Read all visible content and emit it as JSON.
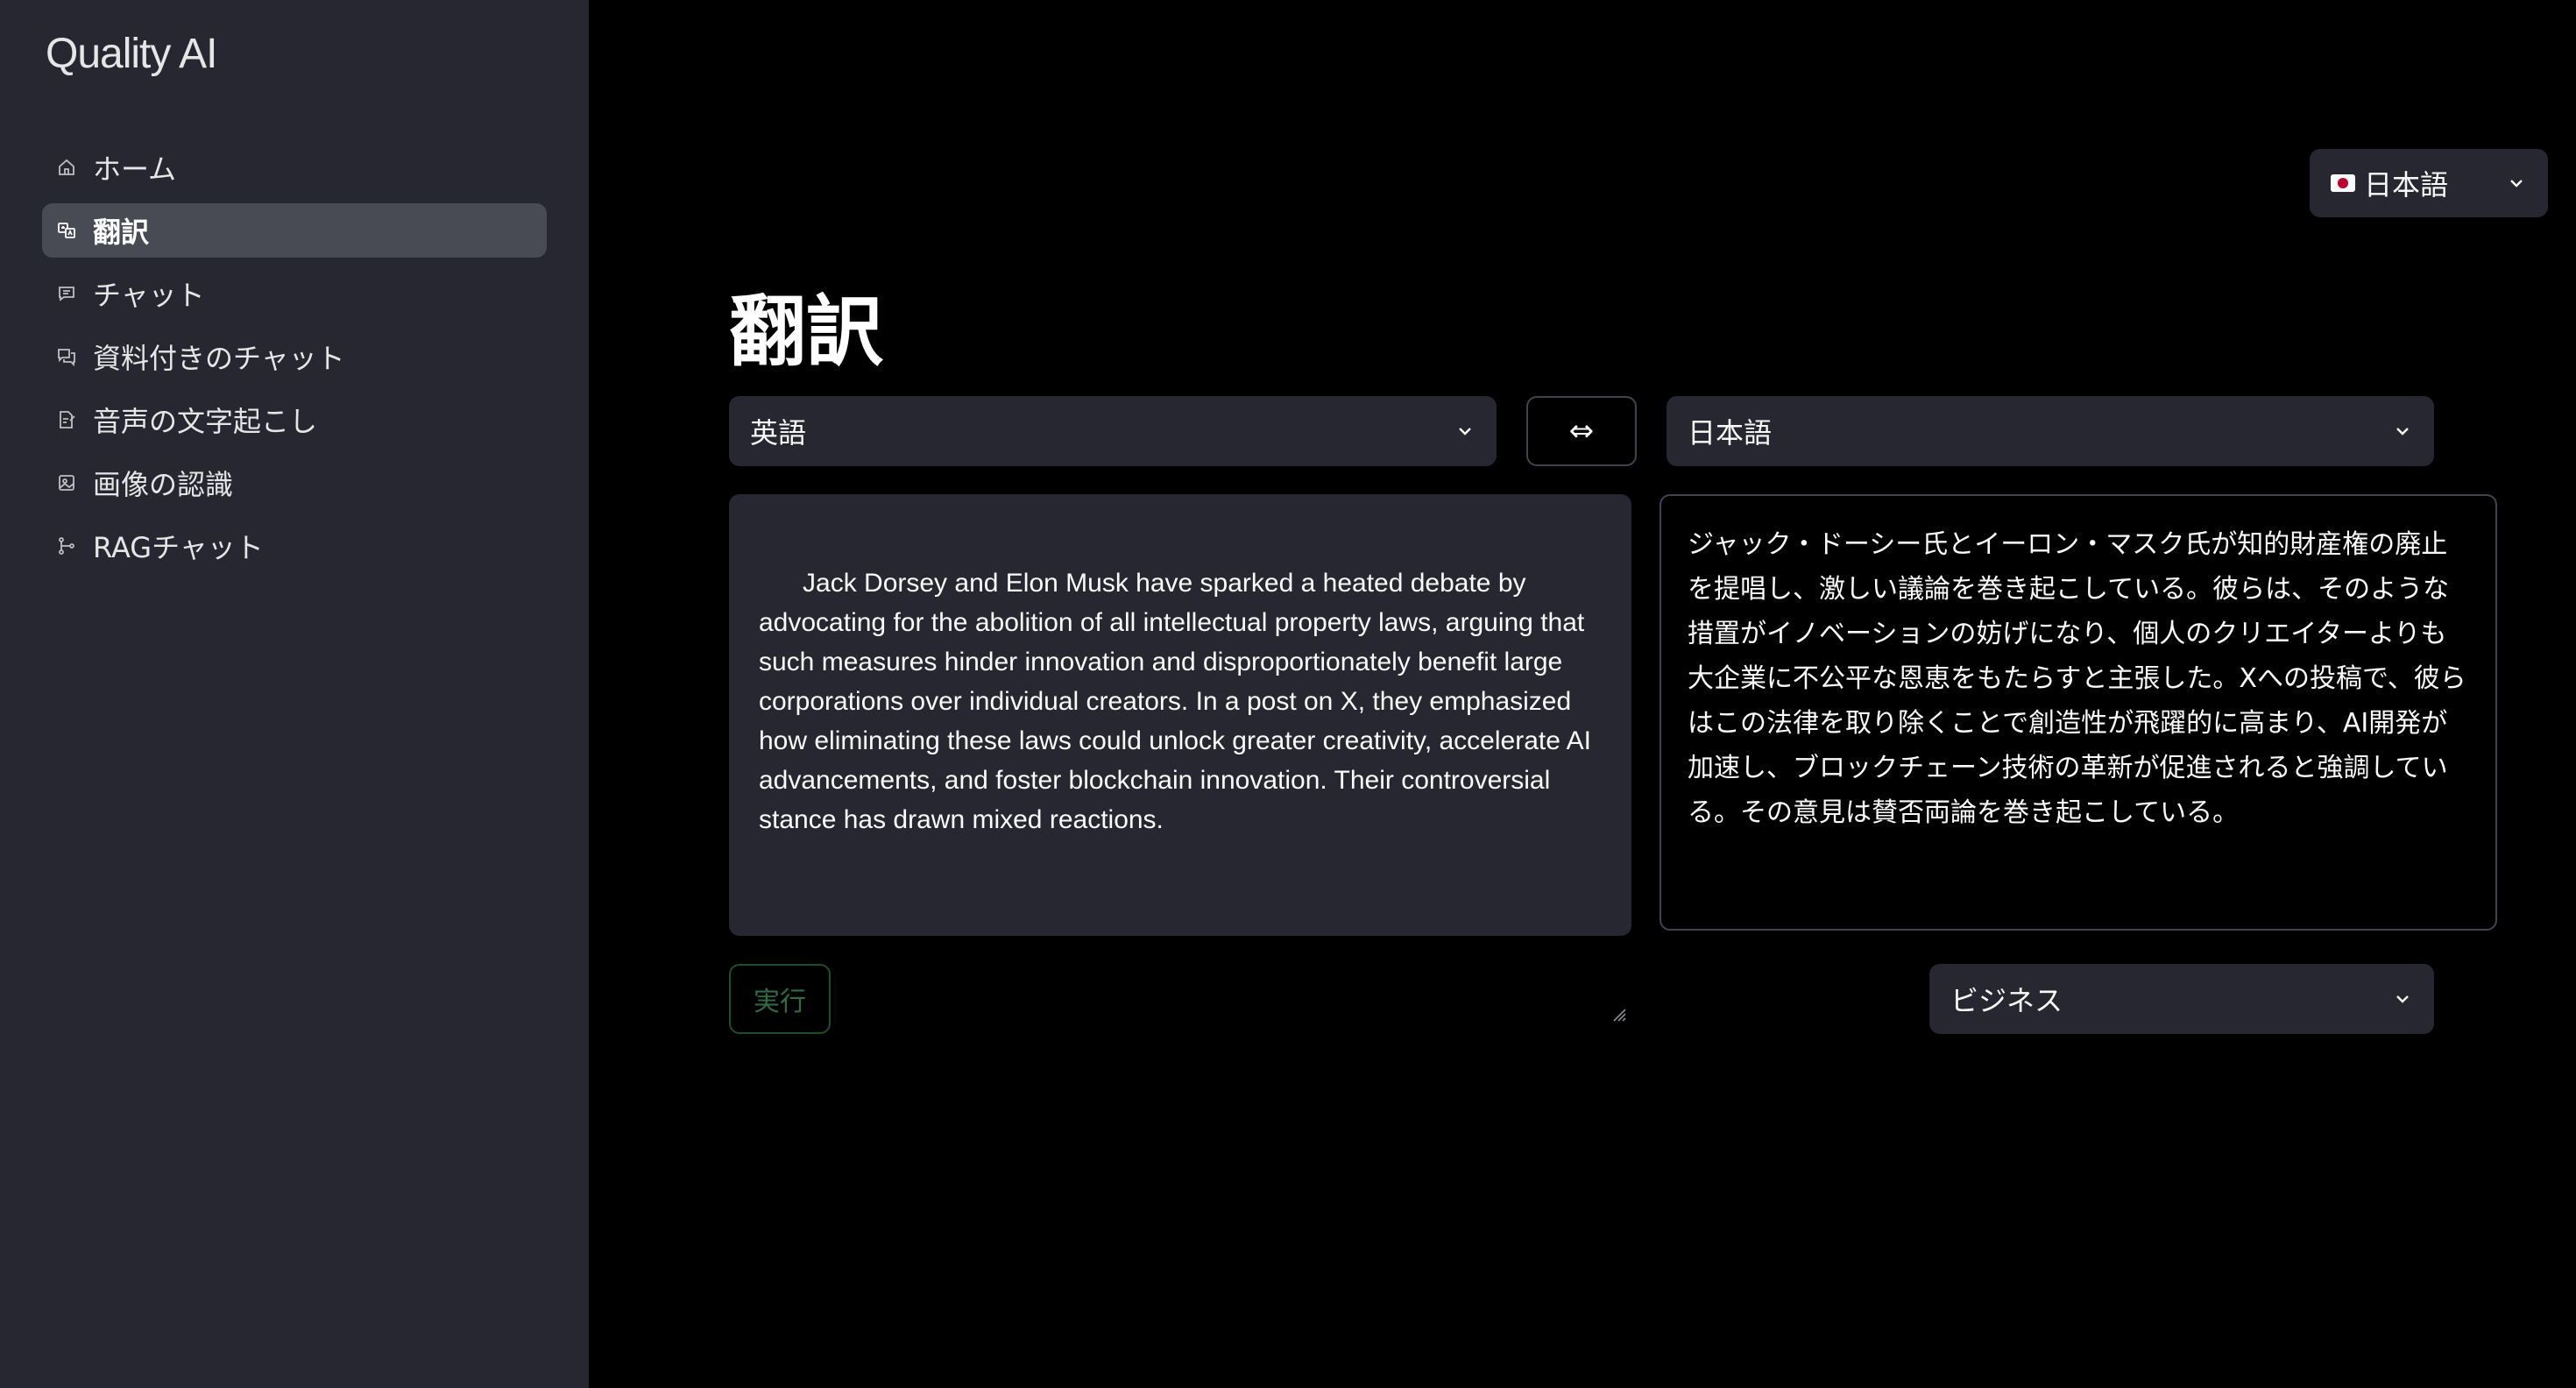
{
  "app": {
    "brand": "Quality AI"
  },
  "sidebar": {
    "items": [
      {
        "label": "ホーム",
        "icon": "home-icon",
        "active": false
      },
      {
        "label": "翻訳",
        "icon": "translate-icon",
        "active": true
      },
      {
        "label": "チャット",
        "icon": "chat-icon",
        "active": false
      },
      {
        "label": "資料付きのチャット",
        "icon": "chat-document-icon",
        "active": false
      },
      {
        "label": "音声の文字起こし",
        "icon": "transcribe-icon",
        "active": false
      },
      {
        "label": "画像の認識",
        "icon": "image-icon",
        "active": false
      },
      {
        "label": "RAGチャット",
        "icon": "rag-icon",
        "active": false
      }
    ]
  },
  "header": {
    "ui_language": "日本語",
    "ui_language_flag": "jp-flag-icon"
  },
  "main": {
    "title": "翻訳",
    "source_language": "英語",
    "target_language": "日本語",
    "swap_label": "⇔",
    "source_text": "Jack Dorsey and Elon Musk have sparked a heated debate by advocating for the abolition of all intellectual property laws, arguing that such measures hinder innovation and disproportionately benefit large corporations over individual creators. In a post on X, they emphasized how eliminating these laws could unlock greater creativity, accelerate AI advancements, and foster blockchain innovation. Their controversial stance has drawn mixed reactions.",
    "translated_text": "ジャック・ドーシー氏とイーロン・マスク氏が知的財産権の廃止を提唱し、激しい議論を巻き起こしている。彼らは、そのような措置がイノベーションの妨げになり、個人のクリエイターよりも大企業に不公平な恩恵をもたらすと主張した。Xへの投稿で、彼らはこの法律を取り除くことで創造性が飛躍的に高まり、AI開発が加速し、ブロックチェーン技術の革新が促進されると強調している。その意見は賛否両論を巻き起こしている。",
    "run_label": "実行",
    "tone": "ビジネス"
  },
  "colors": {
    "background": "#000000",
    "sidebar": "#262730",
    "active_item": "#484a54",
    "input": "#262730",
    "run_disabled": "#2f6b45"
  }
}
